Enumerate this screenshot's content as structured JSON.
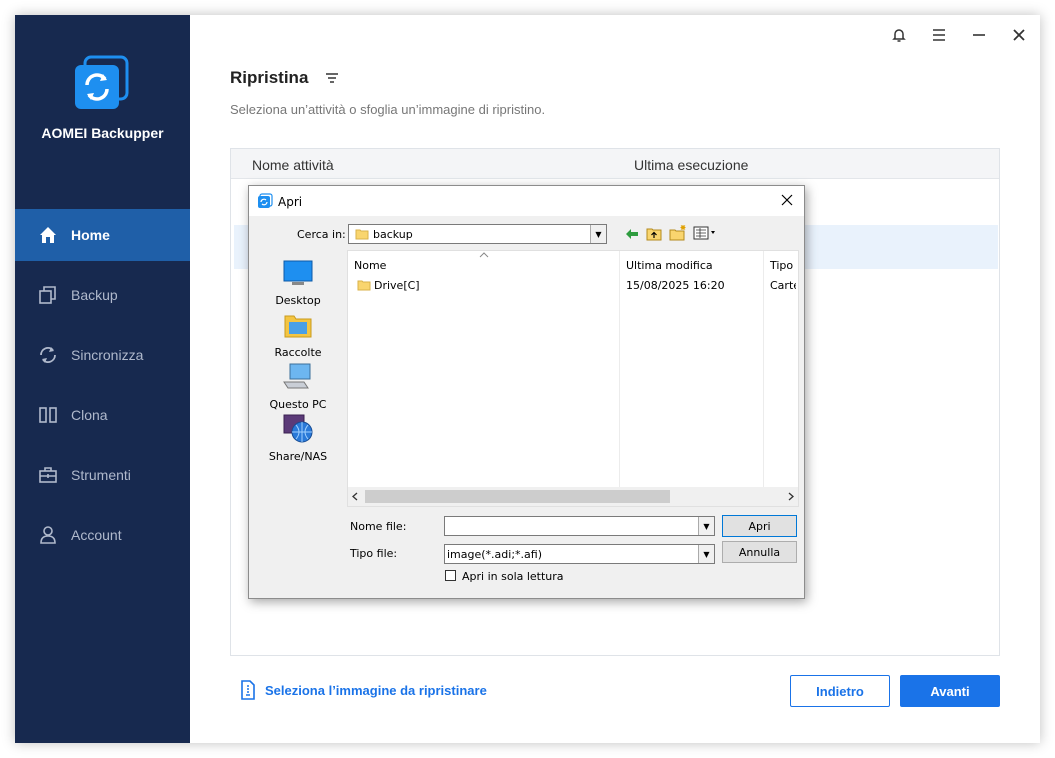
{
  "app": {
    "name": "AOMEI Backupper"
  },
  "sidebar": {
    "items": [
      {
        "label": "Home",
        "icon": "home-icon",
        "active": true
      },
      {
        "label": "Backup",
        "icon": "backup-icon",
        "active": false
      },
      {
        "label": "Sincronizza",
        "icon": "sync-icon",
        "active": false
      },
      {
        "label": "Clona",
        "icon": "clone-icon",
        "active": false
      },
      {
        "label": "Strumenti",
        "icon": "tools-icon",
        "active": false
      },
      {
        "label": "Account",
        "icon": "account-icon",
        "active": false
      }
    ]
  },
  "topbar": {
    "icons": [
      "bell-icon",
      "menu-icon",
      "minimize-icon",
      "close-icon"
    ]
  },
  "main": {
    "title": "Ripristina",
    "subtitle": "Seleziona un’attività o sfoglia un’immagine di ripristino.",
    "table": {
      "columns": [
        "Nome attività",
        "Ultima esecuzione"
      ]
    },
    "select_image_link": "Seleziona l’immagine da ripristinare",
    "back_button": "Indietro",
    "next_button": "Avanti"
  },
  "dialog": {
    "title": "Apri",
    "look_in_label": "Cerca in:",
    "look_in_value": "backup",
    "places": [
      "Desktop",
      "Raccolte",
      "Questo PC",
      "Share/NAS"
    ],
    "columns": [
      "Nome",
      "Ultima modifica",
      "Tipo"
    ],
    "files": [
      {
        "name": "Drive[C]",
        "modified": "15/08/2025 16:20",
        "type": "Carte"
      }
    ],
    "file_name_label": "Nome file:",
    "file_name_value": "",
    "file_type_label": "Tipo file:",
    "file_type_value": "image(*.adi;*.afi)",
    "open_button": "Apri",
    "cancel_button": "Annulla",
    "readonly_label": "Apri in sola lettura"
  },
  "colors": {
    "sidebar_bg": "#17294f",
    "active_nav": "#1f5fa8",
    "accent": "#1a73e8"
  }
}
